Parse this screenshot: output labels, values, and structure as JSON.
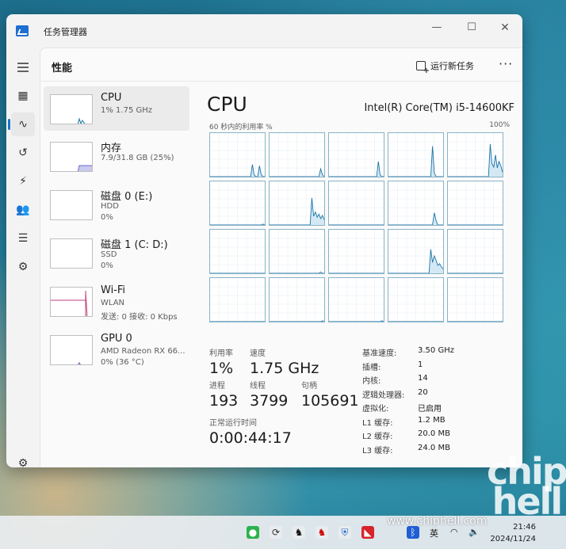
{
  "window": {
    "title": "任务管理器",
    "minimize": "—",
    "maximize": "☐",
    "close": "✕"
  },
  "nav": {
    "menu_icon": "hamburger-icon",
    "items": [
      {
        "icon": "processes-icon",
        "glyph": "▦"
      },
      {
        "icon": "performance-icon",
        "glyph": "∿",
        "active": true
      },
      {
        "icon": "app-history-icon",
        "glyph": "↺"
      },
      {
        "icon": "startup-icon",
        "glyph": "⚡"
      },
      {
        "icon": "users-icon",
        "glyph": "👥"
      },
      {
        "icon": "details-icon",
        "glyph": "☰"
      },
      {
        "icon": "services-icon",
        "glyph": "⚙"
      }
    ],
    "settings_icon": "gear-icon"
  },
  "header": {
    "title": "性能",
    "run_task": "运行新任务",
    "more": "···"
  },
  "devices": [
    {
      "name": "CPU",
      "sub": "1% 1.75 GHz",
      "sub2": "",
      "color": "#1a73a8",
      "fill": "#d3e8f3"
    },
    {
      "name": "内存",
      "sub": "7.9/31.8 GB (25%)",
      "sub2": "",
      "color": "#6b6cc9",
      "fill": "#c8c9ef"
    },
    {
      "name": "磁盘 0 (E:)",
      "sub": "HDD",
      "sub2": "0%",
      "color": "#4d9b2e",
      "fill": "#d8ecd0"
    },
    {
      "name": "磁盘 1 (C: D:)",
      "sub": "SSD",
      "sub2": "0%",
      "color": "#4d9b2e",
      "fill": "#d8ecd0"
    },
    {
      "name": "Wi-Fi",
      "sub": "WLAN",
      "sub2": "发送: 0 接收: 0 Kbps",
      "color": "#c2417a",
      "fill": "#f3d3df"
    },
    {
      "name": "GPU 0",
      "sub": "AMD Radeon RX 66...",
      "sub2": "0% (36 °C)",
      "color": "#7a3fb5",
      "fill": "#e6d5f3"
    }
  ],
  "detail": {
    "title": "CPU",
    "model": "Intel(R) Core(TM) i5-14600KF",
    "graph_label": "60 秒内的利用率 %",
    "graph_max": "100%",
    "stats": {
      "util_label": "利用率",
      "util_value": "1%",
      "speed_label": "速度",
      "speed_value": "1.75 GHz",
      "proc_label": "进程",
      "proc_value": "193",
      "thread_label": "线程",
      "thread_value": "3799",
      "handle_label": "句柄",
      "handle_value": "105691",
      "uptime_label": "正常运行时间",
      "uptime_value": "0:00:44:17"
    },
    "specs": [
      {
        "label": "基准速度:",
        "value": "3.50 GHz"
      },
      {
        "label": "插槽:",
        "value": "1"
      },
      {
        "label": "内核:",
        "value": "14"
      },
      {
        "label": "逻辑处理器:",
        "value": "20"
      },
      {
        "label": "虚拟化:",
        "value": "已启用"
      },
      {
        "label": "L1 缓存:",
        "value": "1.2 MB"
      },
      {
        "label": "L2 缓存:",
        "value": "20.0 MB"
      },
      {
        "label": "L3 缓存:",
        "value": "24.0 MB"
      }
    ],
    "graph_color": "#1a73a8",
    "graph_fill": "#d3e8f3",
    "core_peaks": [
      [
        0,
        0,
        0,
        0,
        0,
        0,
        0,
        0,
        0,
        0,
        0,
        0,
        0,
        0,
        0,
        0,
        0,
        0,
        0,
        0,
        0,
        0,
        0,
        0,
        28,
        4,
        0,
        0,
        25,
        5,
        0,
        0
      ],
      [
        0,
        0,
        0,
        0,
        0,
        0,
        0,
        0,
        0,
        0,
        0,
        0,
        0,
        0,
        0,
        0,
        0,
        0,
        0,
        0,
        0,
        0,
        0,
        0,
        0,
        0,
        0,
        0,
        0,
        18,
        4,
        0
      ],
      [
        0,
        0,
        0,
        0,
        0,
        0,
        0,
        0,
        0,
        0,
        0,
        0,
        0,
        0,
        0,
        0,
        0,
        0,
        0,
        0,
        0,
        0,
        0,
        0,
        0,
        0,
        0,
        0,
        35,
        4,
        0,
        0
      ],
      [
        0,
        0,
        0,
        0,
        0,
        0,
        0,
        0,
        0,
        0,
        0,
        0,
        0,
        0,
        0,
        0,
        0,
        0,
        0,
        0,
        0,
        0,
        0,
        0,
        0,
        70,
        8,
        0,
        0,
        0,
        0,
        0
      ],
      [
        0,
        0,
        0,
        0,
        0,
        0,
        0,
        0,
        0,
        0,
        0,
        0,
        0,
        0,
        0,
        0,
        0,
        0,
        0,
        0,
        0,
        0,
        0,
        0,
        75,
        30,
        22,
        50,
        20,
        35,
        25,
        10
      ],
      [
        0,
        0,
        0,
        0,
        0,
        0,
        0,
        0,
        0,
        0,
        0,
        0,
        0,
        0,
        0,
        0,
        0,
        0,
        0,
        0,
        0,
        0,
        0,
        0,
        0,
        0,
        0,
        0,
        0,
        0,
        2,
        0
      ],
      [
        0,
        0,
        0,
        0,
        0,
        0,
        0,
        0,
        0,
        0,
        0,
        0,
        0,
        0,
        0,
        0,
        0,
        0,
        0,
        0,
        0,
        0,
        0,
        0,
        62,
        20,
        30,
        18,
        25,
        15,
        22,
        12
      ],
      [
        0,
        0,
        0,
        0,
        0,
        0,
        0,
        0,
        0,
        0,
        0,
        0,
        0,
        0,
        0,
        0,
        0,
        0,
        0,
        0,
        0,
        0,
        0,
        0,
        0,
        0,
        0,
        0,
        0,
        0,
        0,
        0
      ],
      [
        0,
        0,
        0,
        0,
        0,
        0,
        0,
        0,
        0,
        0,
        0,
        0,
        0,
        0,
        0,
        0,
        0,
        0,
        0,
        0,
        0,
        0,
        0,
        0,
        0,
        0,
        28,
        10,
        0,
        0,
        0,
        0
      ],
      [
        0,
        0,
        0,
        0,
        0,
        0,
        0,
        0,
        0,
        0,
        0,
        0,
        0,
        0,
        0,
        0,
        0,
        0,
        0,
        0,
        0,
        0,
        0,
        0,
        0,
        0,
        0,
        0,
        0,
        0,
        0,
        0
      ],
      [
        0,
        0,
        0,
        0,
        0,
        0,
        0,
        0,
        0,
        0,
        0,
        0,
        0,
        0,
        0,
        0,
        0,
        0,
        0,
        0,
        0,
        0,
        0,
        0,
        0,
        0,
        0,
        0,
        0,
        0,
        0,
        0
      ],
      [
        0,
        0,
        0,
        0,
        0,
        0,
        0,
        0,
        0,
        0,
        0,
        0,
        0,
        0,
        0,
        0,
        0,
        0,
        0,
        0,
        0,
        0,
        0,
        0,
        0,
        0,
        0,
        0,
        0,
        3,
        0,
        0
      ],
      [
        0,
        0,
        0,
        0,
        0,
        0,
        0,
        0,
        0,
        0,
        0,
        0,
        0,
        0,
        0,
        0,
        0,
        0,
        0,
        0,
        0,
        0,
        0,
        0,
        0,
        0,
        0,
        0,
        0,
        0,
        0,
        0
      ],
      [
        0,
        0,
        0,
        0,
        0,
        0,
        0,
        0,
        0,
        0,
        0,
        0,
        0,
        0,
        0,
        0,
        0,
        0,
        0,
        0,
        0,
        0,
        0,
        0,
        55,
        25,
        40,
        30,
        18,
        22,
        15,
        10
      ],
      [
        0,
        0,
        0,
        0,
        0,
        0,
        0,
        0,
        0,
        0,
        0,
        0,
        0,
        0,
        0,
        0,
        0,
        0,
        0,
        0,
        0,
        0,
        0,
        0,
        0,
        0,
        0,
        0,
        0,
        0,
        0,
        0
      ],
      [
        0,
        0,
        0,
        0,
        0,
        0,
        0,
        0,
        0,
        0,
        0,
        0,
        0,
        0,
        0,
        0,
        0,
        0,
        0,
        0,
        0,
        0,
        0,
        0,
        0,
        0,
        0,
        0,
        0,
        0,
        0,
        0
      ],
      [
        0,
        0,
        0,
        0,
        0,
        0,
        0,
        0,
        0,
        0,
        0,
        0,
        0,
        0,
        0,
        0,
        0,
        0,
        0,
        0,
        0,
        0,
        0,
        0,
        0,
        0,
        0,
        0,
        0,
        0,
        2,
        0
      ],
      [
        0,
        0,
        0,
        0,
        0,
        0,
        0,
        0,
        0,
        0,
        0,
        0,
        0,
        0,
        0,
        0,
        0,
        0,
        0,
        0,
        0,
        0,
        0,
        0,
        0,
        0,
        0,
        0,
        0,
        0,
        2,
        0
      ],
      [
        0,
        0,
        0,
        0,
        0,
        0,
        0,
        0,
        0,
        0,
        0,
        0,
        0,
        0,
        0,
        0,
        0,
        0,
        0,
        0,
        0,
        0,
        0,
        0,
        0,
        0,
        0,
        0,
        0,
        0,
        0,
        0
      ],
      [
        0,
        0,
        0,
        0,
        0,
        0,
        0,
        0,
        0,
        0,
        0,
        0,
        0,
        0,
        0,
        0,
        0,
        0,
        0,
        0,
        0,
        0,
        0,
        0,
        0,
        0,
        0,
        0,
        0,
        0,
        0,
        0
      ]
    ]
  },
  "taskbar": {
    "lang": "英",
    "time": "21:46",
    "date": "2024/11/24"
  },
  "watermark": {
    "logo": "chip hell",
    "url": "www.chiphell.com"
  }
}
